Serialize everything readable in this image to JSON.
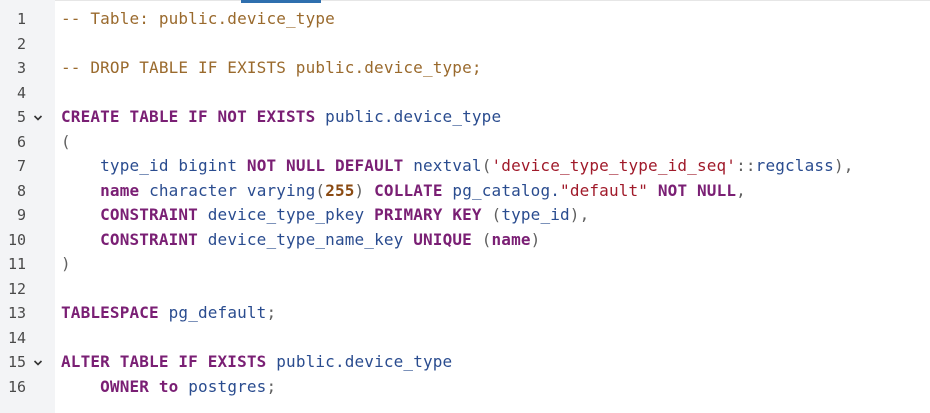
{
  "lines": [
    {
      "n": "1",
      "tokens": [
        {
          "t": "cm",
          "v": "-- Table: public.device_type"
        }
      ]
    },
    {
      "n": "2",
      "tokens": []
    },
    {
      "n": "3",
      "tokens": [
        {
          "t": "cm",
          "v": "-- DROP TABLE IF EXISTS public.device_type;"
        }
      ]
    },
    {
      "n": "4",
      "tokens": []
    },
    {
      "n": "5",
      "fold": true,
      "tokens": [
        {
          "t": "kw",
          "v": "CREATE TABLE IF NOT EXISTS"
        },
        {
          "t": "p",
          "v": " "
        },
        {
          "t": "id",
          "v": "public.device_type"
        }
      ]
    },
    {
      "n": "6",
      "tokens": [
        {
          "t": "op",
          "v": "("
        }
      ]
    },
    {
      "n": "7",
      "tokens": [
        {
          "t": "p",
          "v": "    "
        },
        {
          "t": "id",
          "v": "type_id bigint"
        },
        {
          "t": "p",
          "v": " "
        },
        {
          "t": "kw",
          "v": "NOT NULL DEFAULT"
        },
        {
          "t": "p",
          "v": " "
        },
        {
          "t": "id",
          "v": "nextval"
        },
        {
          "t": "op",
          "v": "("
        },
        {
          "t": "str",
          "v": "'device_type_type_id_seq'"
        },
        {
          "t": "op",
          "v": "::"
        },
        {
          "t": "id",
          "v": "regclass"
        },
        {
          "t": "op",
          "v": "),"
        }
      ]
    },
    {
      "n": "8",
      "tokens": [
        {
          "t": "p",
          "v": "    "
        },
        {
          "t": "kw",
          "v": "name"
        },
        {
          "t": "p",
          "v": " "
        },
        {
          "t": "id",
          "v": "character varying"
        },
        {
          "t": "op",
          "v": "("
        },
        {
          "t": "num",
          "v": "255"
        },
        {
          "t": "op",
          "v": ")"
        },
        {
          "t": "p",
          "v": " "
        },
        {
          "t": "kw",
          "v": "COLLATE"
        },
        {
          "t": "p",
          "v": " "
        },
        {
          "t": "id",
          "v": "pg_catalog."
        },
        {
          "t": "str",
          "v": "\"default\""
        },
        {
          "t": "p",
          "v": " "
        },
        {
          "t": "kw",
          "v": "NOT NULL"
        },
        {
          "t": "op",
          "v": ","
        }
      ]
    },
    {
      "n": "9",
      "tokens": [
        {
          "t": "p",
          "v": "    "
        },
        {
          "t": "kw",
          "v": "CONSTRAINT"
        },
        {
          "t": "p",
          "v": " "
        },
        {
          "t": "id",
          "v": "device_type_pkey"
        },
        {
          "t": "p",
          "v": " "
        },
        {
          "t": "kw",
          "v": "PRIMARY KEY"
        },
        {
          "t": "p",
          "v": " "
        },
        {
          "t": "op",
          "v": "("
        },
        {
          "t": "id",
          "v": "type_id"
        },
        {
          "t": "op",
          "v": "),"
        }
      ]
    },
    {
      "n": "10",
      "tokens": [
        {
          "t": "p",
          "v": "    "
        },
        {
          "t": "kw",
          "v": "CONSTRAINT"
        },
        {
          "t": "p",
          "v": " "
        },
        {
          "t": "id",
          "v": "device_type_name_key"
        },
        {
          "t": "p",
          "v": " "
        },
        {
          "t": "kw",
          "v": "UNIQUE"
        },
        {
          "t": "p",
          "v": " "
        },
        {
          "t": "op",
          "v": "("
        },
        {
          "t": "kw",
          "v": "name"
        },
        {
          "t": "op",
          "v": ")"
        }
      ]
    },
    {
      "n": "11",
      "tokens": [
        {
          "t": "op",
          "v": ")"
        }
      ]
    },
    {
      "n": "12",
      "tokens": []
    },
    {
      "n": "13",
      "tokens": [
        {
          "t": "kw",
          "v": "TABLESPACE"
        },
        {
          "t": "p",
          "v": " "
        },
        {
          "t": "id",
          "v": "pg_default"
        },
        {
          "t": "op",
          "v": ";"
        }
      ]
    },
    {
      "n": "14",
      "tokens": []
    },
    {
      "n": "15",
      "fold": true,
      "tokens": [
        {
          "t": "kw",
          "v": "ALTER TABLE IF EXISTS"
        },
        {
          "t": "p",
          "v": " "
        },
        {
          "t": "id",
          "v": "public.device_type"
        }
      ]
    },
    {
      "n": "16",
      "tokens": [
        {
          "t": "p",
          "v": "    "
        },
        {
          "t": "kw",
          "v": "OWNER to"
        },
        {
          "t": "p",
          "v": " "
        },
        {
          "t": "id",
          "v": "postgres"
        },
        {
          "t": "op",
          "v": ";"
        }
      ]
    }
  ],
  "icons": {
    "fold": "chevron-down-icon"
  }
}
